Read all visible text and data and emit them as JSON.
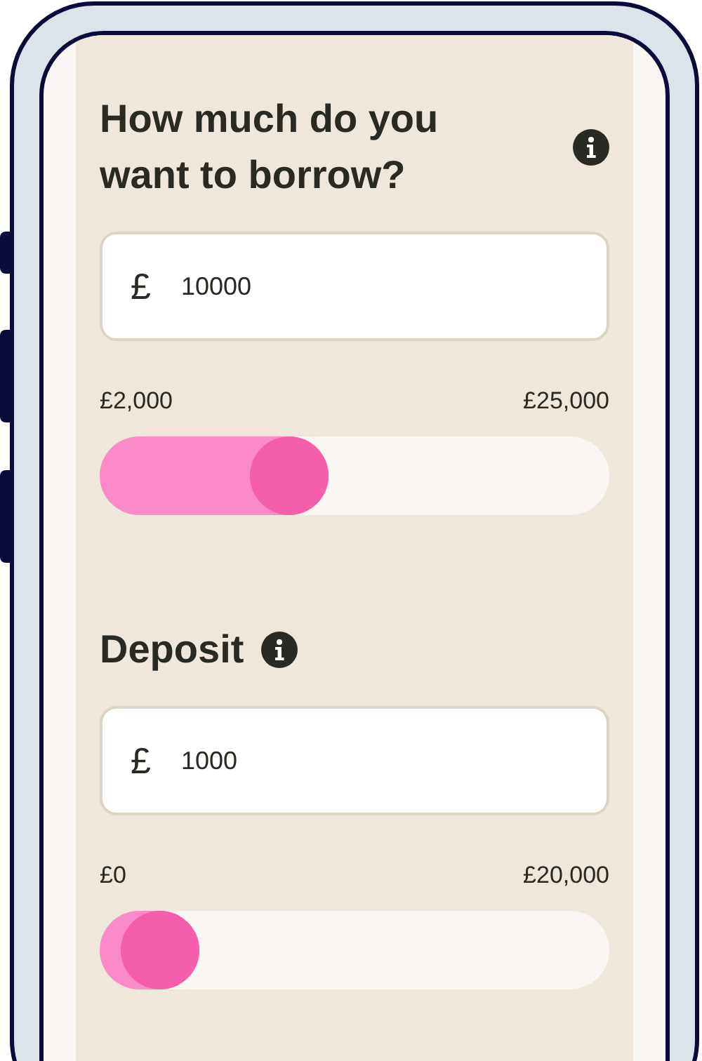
{
  "fields": [
    {
      "title": "How much do you want to borrow?",
      "currency": "£",
      "value": "10000",
      "min_label": "£2,000",
      "max_label": "£25,000",
      "level": 0.348
    },
    {
      "title": "Deposit",
      "currency": "£",
      "value": "1000",
      "min_label": "£0",
      "max_label": "£20,000",
      "level": 0.05
    }
  ]
}
